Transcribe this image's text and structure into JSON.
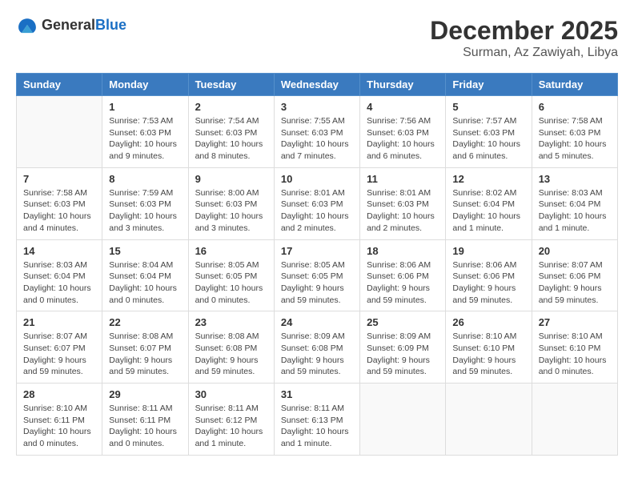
{
  "header": {
    "logo_general": "General",
    "logo_blue": "Blue",
    "month_year": "December 2025",
    "location": "Surman, Az Zawiyah, Libya"
  },
  "days_of_week": [
    "Sunday",
    "Monday",
    "Tuesday",
    "Wednesday",
    "Thursday",
    "Friday",
    "Saturday"
  ],
  "weeks": [
    [
      {
        "day": "",
        "info": ""
      },
      {
        "day": "1",
        "info": "Sunrise: 7:53 AM\nSunset: 6:03 PM\nDaylight: 10 hours\nand 9 minutes."
      },
      {
        "day": "2",
        "info": "Sunrise: 7:54 AM\nSunset: 6:03 PM\nDaylight: 10 hours\nand 8 minutes."
      },
      {
        "day": "3",
        "info": "Sunrise: 7:55 AM\nSunset: 6:03 PM\nDaylight: 10 hours\nand 7 minutes."
      },
      {
        "day": "4",
        "info": "Sunrise: 7:56 AM\nSunset: 6:03 PM\nDaylight: 10 hours\nand 6 minutes."
      },
      {
        "day": "5",
        "info": "Sunrise: 7:57 AM\nSunset: 6:03 PM\nDaylight: 10 hours\nand 6 minutes."
      },
      {
        "day": "6",
        "info": "Sunrise: 7:58 AM\nSunset: 6:03 PM\nDaylight: 10 hours\nand 5 minutes."
      }
    ],
    [
      {
        "day": "7",
        "info": "Sunrise: 7:58 AM\nSunset: 6:03 PM\nDaylight: 10 hours\nand 4 minutes."
      },
      {
        "day": "8",
        "info": "Sunrise: 7:59 AM\nSunset: 6:03 PM\nDaylight: 10 hours\nand 3 minutes."
      },
      {
        "day": "9",
        "info": "Sunrise: 8:00 AM\nSunset: 6:03 PM\nDaylight: 10 hours\nand 3 minutes."
      },
      {
        "day": "10",
        "info": "Sunrise: 8:01 AM\nSunset: 6:03 PM\nDaylight: 10 hours\nand 2 minutes."
      },
      {
        "day": "11",
        "info": "Sunrise: 8:01 AM\nSunset: 6:03 PM\nDaylight: 10 hours\nand 2 minutes."
      },
      {
        "day": "12",
        "info": "Sunrise: 8:02 AM\nSunset: 6:04 PM\nDaylight: 10 hours\nand 1 minute."
      },
      {
        "day": "13",
        "info": "Sunrise: 8:03 AM\nSunset: 6:04 PM\nDaylight: 10 hours\nand 1 minute."
      }
    ],
    [
      {
        "day": "14",
        "info": "Sunrise: 8:03 AM\nSunset: 6:04 PM\nDaylight: 10 hours\nand 0 minutes."
      },
      {
        "day": "15",
        "info": "Sunrise: 8:04 AM\nSunset: 6:04 PM\nDaylight: 10 hours\nand 0 minutes."
      },
      {
        "day": "16",
        "info": "Sunrise: 8:05 AM\nSunset: 6:05 PM\nDaylight: 10 hours\nand 0 minutes."
      },
      {
        "day": "17",
        "info": "Sunrise: 8:05 AM\nSunset: 6:05 PM\nDaylight: 9 hours\nand 59 minutes."
      },
      {
        "day": "18",
        "info": "Sunrise: 8:06 AM\nSunset: 6:06 PM\nDaylight: 9 hours\nand 59 minutes."
      },
      {
        "day": "19",
        "info": "Sunrise: 8:06 AM\nSunset: 6:06 PM\nDaylight: 9 hours\nand 59 minutes."
      },
      {
        "day": "20",
        "info": "Sunrise: 8:07 AM\nSunset: 6:06 PM\nDaylight: 9 hours\nand 59 minutes."
      }
    ],
    [
      {
        "day": "21",
        "info": "Sunrise: 8:07 AM\nSunset: 6:07 PM\nDaylight: 9 hours\nand 59 minutes."
      },
      {
        "day": "22",
        "info": "Sunrise: 8:08 AM\nSunset: 6:07 PM\nDaylight: 9 hours\nand 59 minutes."
      },
      {
        "day": "23",
        "info": "Sunrise: 8:08 AM\nSunset: 6:08 PM\nDaylight: 9 hours\nand 59 minutes."
      },
      {
        "day": "24",
        "info": "Sunrise: 8:09 AM\nSunset: 6:08 PM\nDaylight: 9 hours\nand 59 minutes."
      },
      {
        "day": "25",
        "info": "Sunrise: 8:09 AM\nSunset: 6:09 PM\nDaylight: 9 hours\nand 59 minutes."
      },
      {
        "day": "26",
        "info": "Sunrise: 8:10 AM\nSunset: 6:10 PM\nDaylight: 9 hours\nand 59 minutes."
      },
      {
        "day": "27",
        "info": "Sunrise: 8:10 AM\nSunset: 6:10 PM\nDaylight: 10 hours\nand 0 minutes."
      }
    ],
    [
      {
        "day": "28",
        "info": "Sunrise: 8:10 AM\nSunset: 6:11 PM\nDaylight: 10 hours\nand 0 minutes."
      },
      {
        "day": "29",
        "info": "Sunrise: 8:11 AM\nSunset: 6:11 PM\nDaylight: 10 hours\nand 0 minutes."
      },
      {
        "day": "30",
        "info": "Sunrise: 8:11 AM\nSunset: 6:12 PM\nDaylight: 10 hours\nand 1 minute."
      },
      {
        "day": "31",
        "info": "Sunrise: 8:11 AM\nSunset: 6:13 PM\nDaylight: 10 hours\nand 1 minute."
      },
      {
        "day": "",
        "info": ""
      },
      {
        "day": "",
        "info": ""
      },
      {
        "day": "",
        "info": ""
      }
    ]
  ]
}
